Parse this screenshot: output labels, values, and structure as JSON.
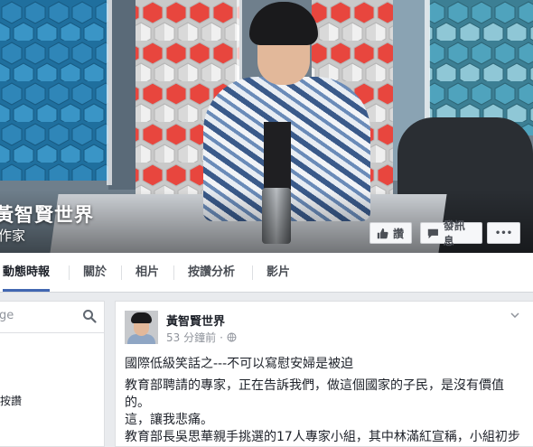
{
  "cover": {
    "page_name": "黃智賢世界",
    "category": "作家",
    "buttons": {
      "like": "讚",
      "message": "發訊息",
      "more": "•••"
    }
  },
  "nav": {
    "tabs": [
      {
        "label": "動態時報",
        "active": true
      },
      {
        "label": "關於",
        "active": false
      },
      {
        "label": "相片",
        "active": false
      },
      {
        "label": "按讚分析",
        "active": false
      },
      {
        "label": "影片",
        "active": false
      }
    ]
  },
  "sidebar": {
    "search_placeholder": "ge",
    "like_text": "按讚"
  },
  "post": {
    "author": "黃智賢世界",
    "time": "53 分鐘前",
    "separator": "·",
    "lines": [
      "國際低級笑話之---不可以寫慰安婦是被迫",
      "教育部聘請的專家，正在告訴我們，做這個國家的子民，是沒有價值",
      "的。",
      "這，讓我悲痛。",
      "教育部長吳思華親手挑選的17人專家小組，其中林滿紅宣稱，小組初步"
    ]
  },
  "colors": {
    "brand": "#4267b2",
    "cover_hex_red": "#e8463e",
    "cover_hex_blue": "#2f86b8"
  }
}
